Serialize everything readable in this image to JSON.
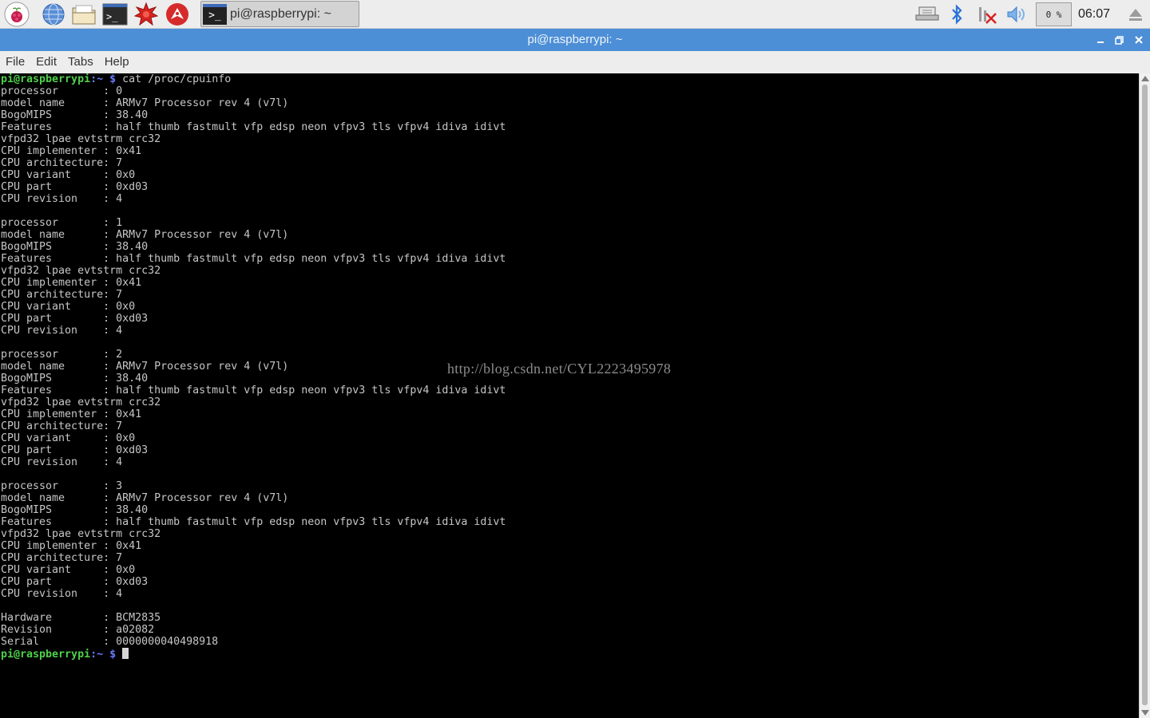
{
  "taskbar": {
    "launchers": [
      {
        "icon": "raspberry-menu-icon"
      },
      {
        "icon": "web-browser-icon"
      },
      {
        "icon": "file-manager-icon"
      },
      {
        "icon": "terminal-icon"
      },
      {
        "icon": "math-kernel-icon"
      },
      {
        "icon": "wolfram-icon"
      }
    ],
    "task_button": {
      "label": "pi@raspberrypi: ~",
      "icon": "terminal-icon"
    },
    "tray": {
      "network_icon": "network-icon",
      "bluetooth_icon": "bluetooth-icon",
      "wifi_icon": "wifi-disconnected-icon",
      "volume_icon": "volume-icon",
      "cpu_usage": "0 %",
      "clock": "06:07",
      "eject_icon": "eject-icon"
    }
  },
  "window": {
    "title": "pi@raspberrypi: ~",
    "accent": "#4d8fd6"
  },
  "menubar": {
    "items": [
      "File",
      "Edit",
      "Tabs",
      "Help"
    ]
  },
  "terminal": {
    "prompt_user": "pi@raspberrypi",
    "prompt_sep": ":~ $",
    "command": " cat /proc/cpuinfo",
    "output": [
      "processor       : 0",
      "model name      : ARMv7 Processor rev 4 (v7l)",
      "BogoMIPS        : 38.40",
      "Features        : half thumb fastmult vfp edsp neon vfpv3 tls vfpv4 idiva idivt",
      "vfpd32 lpae evtstrm crc32",
      "CPU implementer : 0x41",
      "CPU architecture: 7",
      "CPU variant     : 0x0",
      "CPU part        : 0xd03",
      "CPU revision    : 4",
      "",
      "processor       : 1",
      "model name      : ARMv7 Processor rev 4 (v7l)",
      "BogoMIPS        : 38.40",
      "Features        : half thumb fastmult vfp edsp neon vfpv3 tls vfpv4 idiva idivt",
      "vfpd32 lpae evtstrm crc32",
      "CPU implementer : 0x41",
      "CPU architecture: 7",
      "CPU variant     : 0x0",
      "CPU part        : 0xd03",
      "CPU revision    : 4",
      "",
      "processor       : 2",
      "model name      : ARMv7 Processor rev 4 (v7l)",
      "BogoMIPS        : 38.40",
      "Features        : half thumb fastmult vfp edsp neon vfpv3 tls vfpv4 idiva idivt",
      "vfpd32 lpae evtstrm crc32",
      "CPU implementer : 0x41",
      "CPU architecture: 7",
      "CPU variant     : 0x0",
      "CPU part        : 0xd03",
      "CPU revision    : 4",
      "",
      "processor       : 3",
      "model name      : ARMv7 Processor rev 4 (v7l)",
      "BogoMIPS        : 38.40",
      "Features        : half thumb fastmult vfp edsp neon vfpv3 tls vfpv4 idiva idivt",
      "vfpd32 lpae evtstrm crc32",
      "CPU implementer : 0x41",
      "CPU architecture: 7",
      "CPU variant     : 0x0",
      "CPU part        : 0xd03",
      "CPU revision    : 4",
      "",
      "Hardware        : BCM2835",
      "Revision        : a02082",
      "Serial          : 0000000040498918"
    ],
    "watermark": "http://blog.csdn.net/CYL2223495978",
    "colors": {
      "user": "#4fd04a",
      "path": "#6a7cff",
      "text": "#c6c6c6",
      "background": "#000000"
    }
  }
}
